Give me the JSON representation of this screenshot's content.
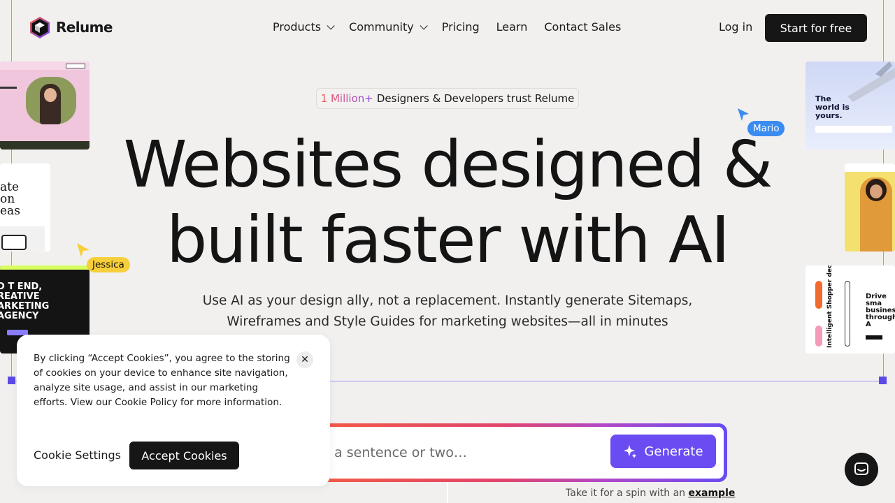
{
  "brand": {
    "name": "Relume"
  },
  "nav": {
    "items": [
      {
        "label": "Products",
        "dropdown": true
      },
      {
        "label": "Community",
        "dropdown": true
      },
      {
        "label": "Pricing",
        "dropdown": false
      },
      {
        "label": "Learn",
        "dropdown": false
      },
      {
        "label": "Contact Sales",
        "dropdown": false
      }
    ],
    "login_label": "Log in",
    "cta_label": "Start for free"
  },
  "hero": {
    "trust_highlight": "1 Million+",
    "trust_text": "Designers & Developers trust Relume",
    "headline_line1": "Websites designed &",
    "headline_line2": "built faster with AI",
    "subtitle": "Use AI as your design ally, not a replacement. Instantly generate Sitemaps, Wireframes and Style Guides for marketing websites—all in minutes"
  },
  "cursors": [
    {
      "name": "Mario",
      "color": "#3b8cf0"
    },
    {
      "name": "Jessica",
      "color": "#f7cf3a"
    }
  ],
  "thumbnails": {
    "t2_text": "ate on eas",
    "t3_text": "D T END, REATIVE ARKETING AGENCY",
    "t4_text": "The world is yours.",
    "t6_text": "Drive sma business through A",
    "t6_vertical": "Intelligent Shopper decision with AI"
  },
  "prompt": {
    "placeholder": "n a sentence or two…",
    "generate_label": "Generate",
    "spin_prefix": "Take it for a spin with an",
    "spin_link": "example"
  },
  "cookie": {
    "text": "By clicking “Accept Cookies”, you agree to the storing of cookies on your device to enhance site navigation, analyze site usage, and assist in our marketing efforts. View our Cookie Policy for more information.",
    "settings_label": "Cookie Settings",
    "accept_label": "Accept Cookies",
    "close_symbol": "✕"
  },
  "colors": {
    "background": "#f2f0ef",
    "dark": "#161616",
    "accent_purple": "#6a4cf2",
    "guide": "#8b7cf6"
  }
}
